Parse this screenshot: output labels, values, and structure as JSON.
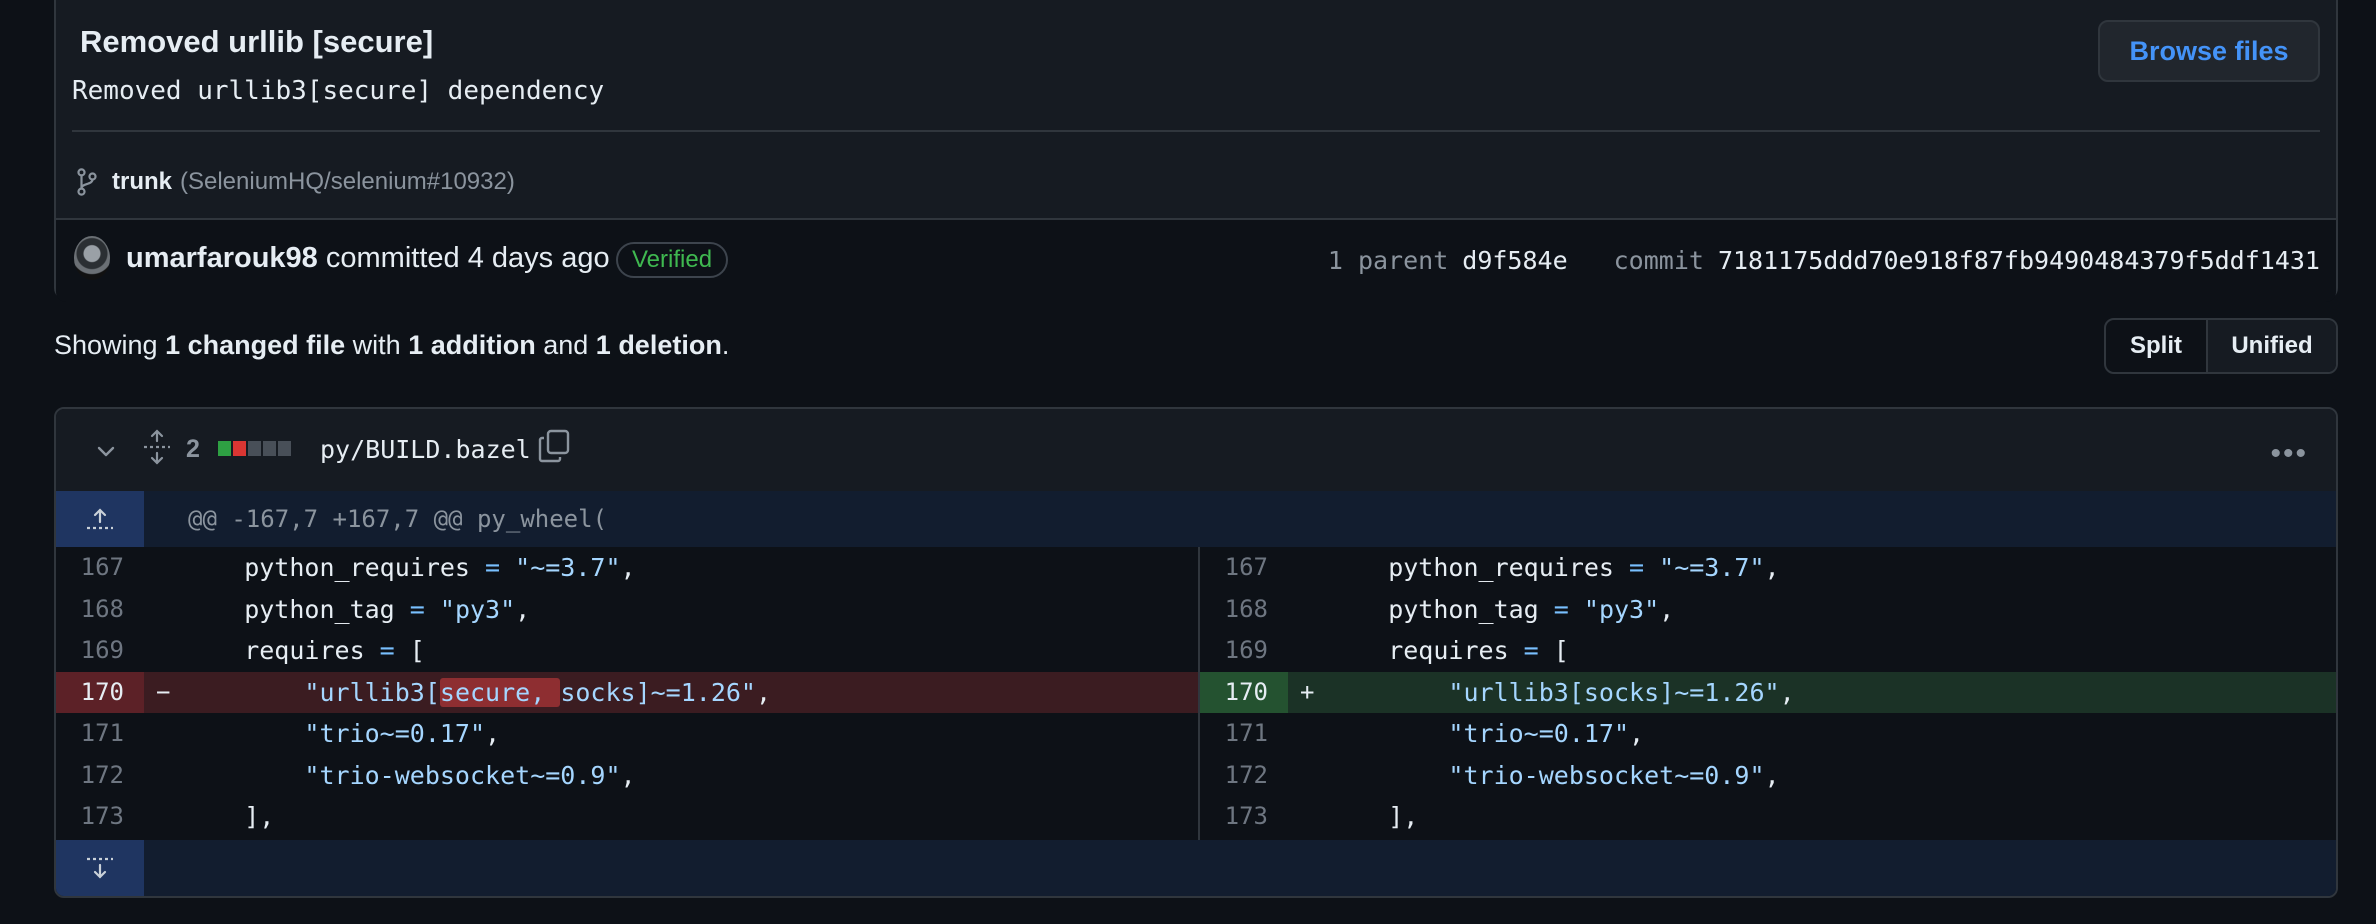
{
  "commit": {
    "title": "Removed urllib [secure]",
    "description": "Removed urllib3[secure] dependency",
    "browse_label": "Browse files",
    "branch": "trunk",
    "ref": "(SeleniumHQ/selenium#10932)",
    "author": "umarfarouk98",
    "action": "committed 4 days ago",
    "verified_label": "Verified",
    "parent_label": "1 parent",
    "parent_sha": "d9f584e",
    "commit_label": "commit",
    "commit_sha": "7181175ddd70e918f87fb9490484379f5ddf1431"
  },
  "summary": {
    "prefix": "Showing",
    "changed": "1 changed file",
    "with": "with",
    "additions": "1 addition",
    "and": "and",
    "deletions": "1 deletion",
    "suffix": "."
  },
  "view_toggle": {
    "split": "Split",
    "unified": "Unified",
    "selected": "Unified"
  },
  "file": {
    "change_count": "2",
    "path": "py/BUILD.bazel",
    "diffstat": [
      "added",
      "removed",
      "neutral",
      "neutral",
      "neutral"
    ],
    "colors": {
      "added": "#2ea043",
      "removed": "#da3633",
      "neutral": "#484f58"
    },
    "hunk_header": "@@ -167,7 +167,7 @@ py_wheel(",
    "left": [
      {
        "num": "167",
        "type": "ctx",
        "code": "    python_requires = \"~=3.7\","
      },
      {
        "num": "168",
        "type": "ctx",
        "code": "    python_tag = \"py3\","
      },
      {
        "num": "169",
        "type": "ctx",
        "code": "    requires = ["
      },
      {
        "num": "170",
        "type": "del",
        "sign": "−",
        "code": "        \"urllib3[secure, socks]~=1.26\","
      },
      {
        "num": "171",
        "type": "ctx",
        "code": "        \"trio~=0.17\","
      },
      {
        "num": "172",
        "type": "ctx",
        "code": "        \"trio-websocket~=0.9\","
      },
      {
        "num": "173",
        "type": "ctx",
        "code": "    ],"
      }
    ],
    "right": [
      {
        "num": "167",
        "type": "ctx",
        "code": "    python_requires = \"~=3.7\","
      },
      {
        "num": "168",
        "type": "ctx",
        "code": "    python_tag = \"py3\","
      },
      {
        "num": "169",
        "type": "ctx",
        "code": "    requires = ["
      },
      {
        "num": "170",
        "type": "add",
        "sign": "+",
        "code": "        \"urllib3[socks]~=1.26\","
      },
      {
        "num": "171",
        "type": "ctx",
        "code": "        \"trio~=0.17\","
      },
      {
        "num": "172",
        "type": "ctx",
        "code": "        \"trio-websocket~=0.9\","
      },
      {
        "num": "173",
        "type": "ctx",
        "code": "    ],"
      }
    ],
    "deleted_highlight": "secure, "
  }
}
